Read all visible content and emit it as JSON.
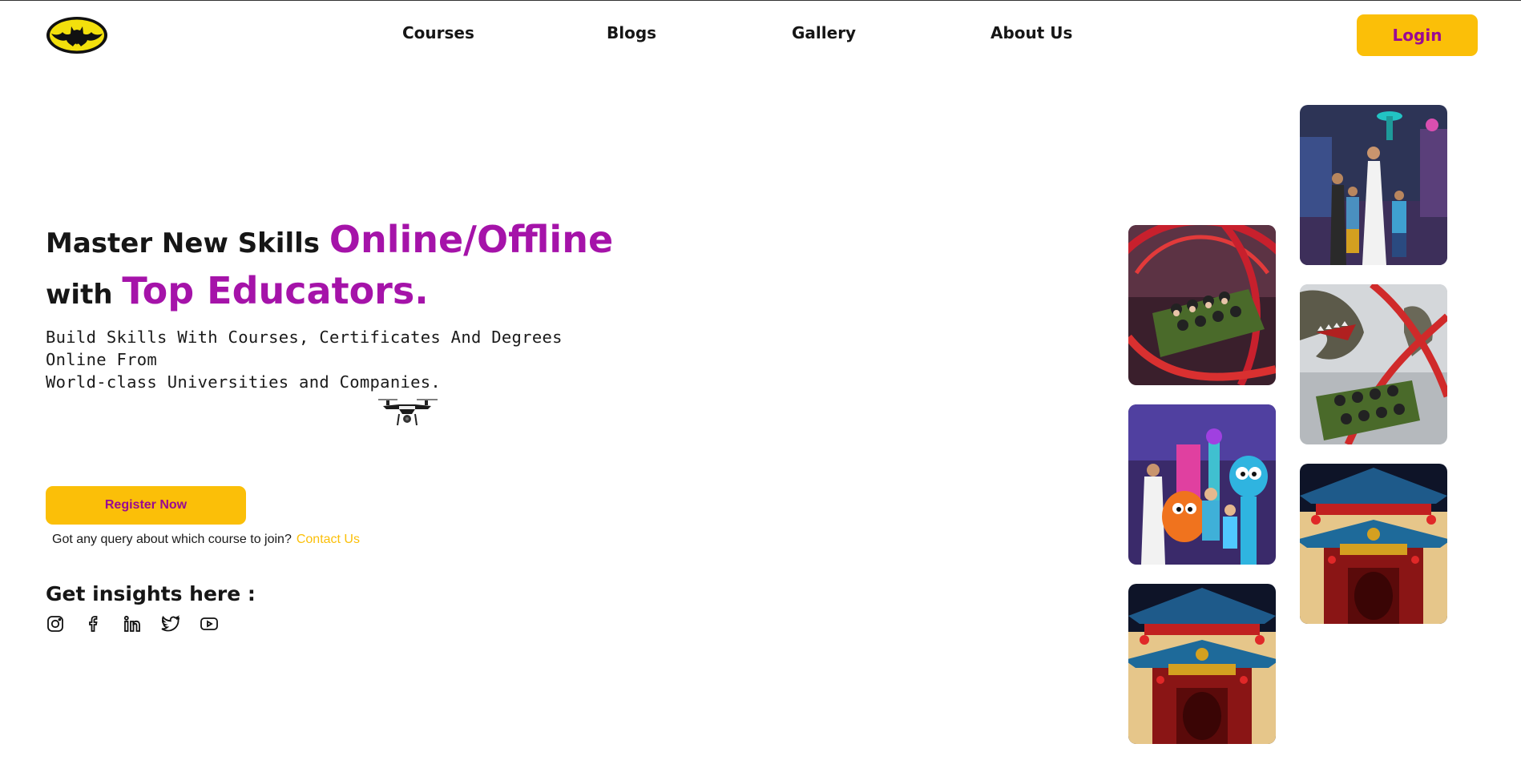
{
  "nav": {
    "logo_icon": "batman-logo-icon",
    "links": [
      "Courses",
      "Blogs",
      "Gallery",
      "About Us"
    ],
    "login_label": "Login"
  },
  "hero": {
    "line1_plain": "Master New Skills ",
    "line1_accent": "Online/Offline",
    "line2_plain": "with ",
    "line2_accent": "Top Educators.",
    "subtitle_line1": "Build Skills With Courses, Certificates And Degrees Online From",
    "subtitle_line2": "World-class Universities and Companies.",
    "drone_icon": "drone-icon"
  },
  "cta": {
    "register_label": "Register Now",
    "query_text": "Got any query about which course to join?",
    "contact_label": "Contact Us"
  },
  "insights": {
    "heading": "Get insights here :",
    "icons": [
      "instagram-icon",
      "facebook-icon",
      "linkedin-icon",
      "twitter-icon",
      "youtube-icon"
    ]
  },
  "gallery": {
    "images": [
      "rollercoaster-photo",
      "theme-park-family-photo",
      "cartoon-characters-photo",
      "dinosaur-rollercoaster-photo",
      "chinese-temple-photo",
      "chinese-temple-photo"
    ]
  },
  "colors": {
    "accent_yellow": "#fbbf08",
    "accent_purple": "#a513a9",
    "button_text": "#9a0a93"
  }
}
